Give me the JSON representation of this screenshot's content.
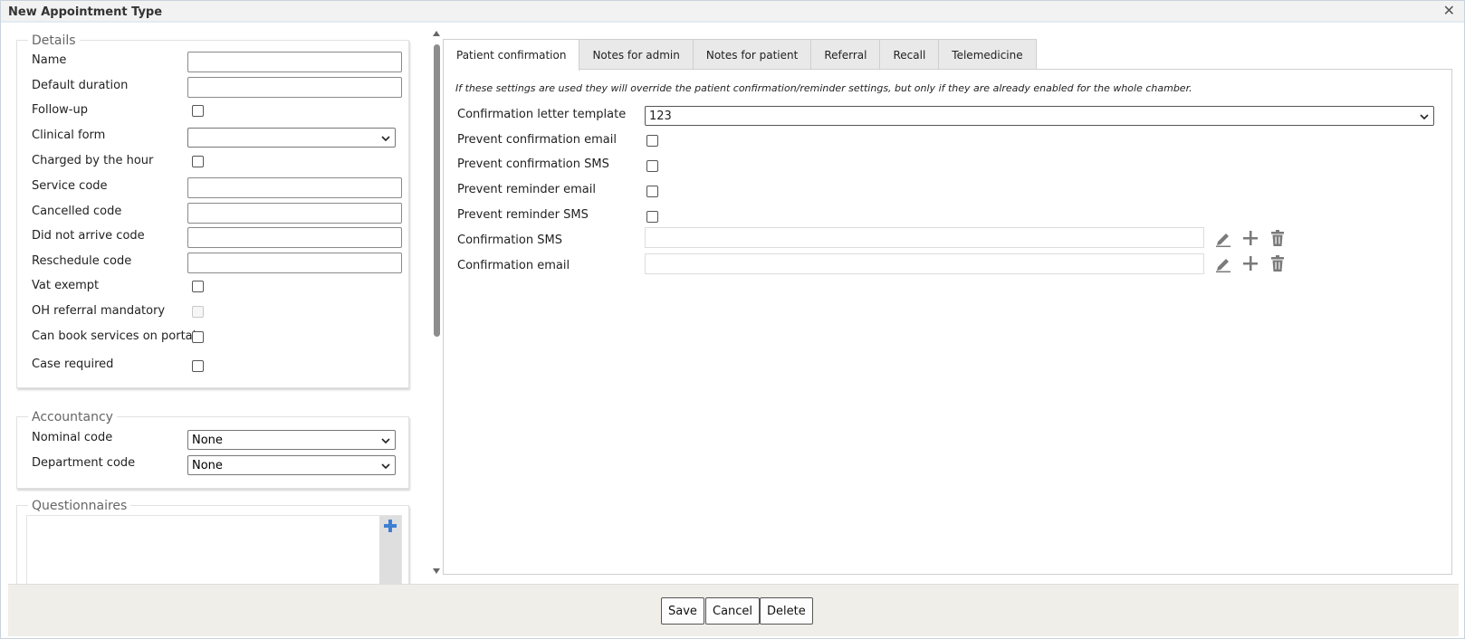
{
  "window": {
    "title": "New Appointment Type",
    "close_glyph": "✕"
  },
  "details": {
    "legend": "Details",
    "fields": {
      "name": "Name",
      "default_duration": "Default duration",
      "follow_up": "Follow-up",
      "clinical_form": "Clinical form",
      "charged_by_hour": "Charged by the hour",
      "service_code": "Service code",
      "cancelled_code": "Cancelled code",
      "did_not_arrive_code": "Did not arrive code",
      "reschedule_code": "Reschedule code",
      "vat_exempt": "Vat exempt",
      "oh_referral_mandatory": "OH referral mandatory",
      "can_book_portal": "Can book services on portal",
      "case_required": "Case required"
    },
    "values": {
      "name": "",
      "default_duration": "",
      "clinical_form": "",
      "service_code": "",
      "cancelled_code": "",
      "did_not_arrive_code": "",
      "reschedule_code": ""
    }
  },
  "accountancy": {
    "legend": "Accountancy",
    "nominal_code_label": "Nominal code",
    "nominal_code_value": "None",
    "department_code_label": "Department code",
    "department_code_value": "None"
  },
  "questionnaires": {
    "legend": "Questionnaires",
    "add_icon": "plus-icon"
  },
  "tabs": [
    {
      "label": "Patient confirmation",
      "active": true
    },
    {
      "label": "Notes for admin",
      "active": false
    },
    {
      "label": "Notes for patient",
      "active": false
    },
    {
      "label": "Referral",
      "active": false
    },
    {
      "label": "Recall",
      "active": false
    },
    {
      "label": "Telemedicine",
      "active": false
    }
  ],
  "patient_confirmation": {
    "note": "If these settings are used they will override the patient confirmation/reminder settings, but only if they are already enabled for the whole chamber.",
    "template_label": "Confirmation letter template",
    "template_value": "123",
    "prevent_confirmation_email": "Prevent confirmation email",
    "prevent_confirmation_sms": "Prevent confirmation SMS",
    "prevent_reminder_email": "Prevent reminder email",
    "prevent_reminder_sms": "Prevent reminder SMS",
    "confirmation_sms_label": "Confirmation SMS",
    "confirmation_sms_value": "",
    "confirmation_email_label": "Confirmation email",
    "confirmation_email_value": ""
  },
  "footer": {
    "save": "Save",
    "cancel": "Cancel",
    "delete": "Delete"
  },
  "colors": {
    "accent_blue": "#3f7fd1",
    "icon_grey": "#7a7a7a",
    "footer_bg": "#f0eee9"
  }
}
